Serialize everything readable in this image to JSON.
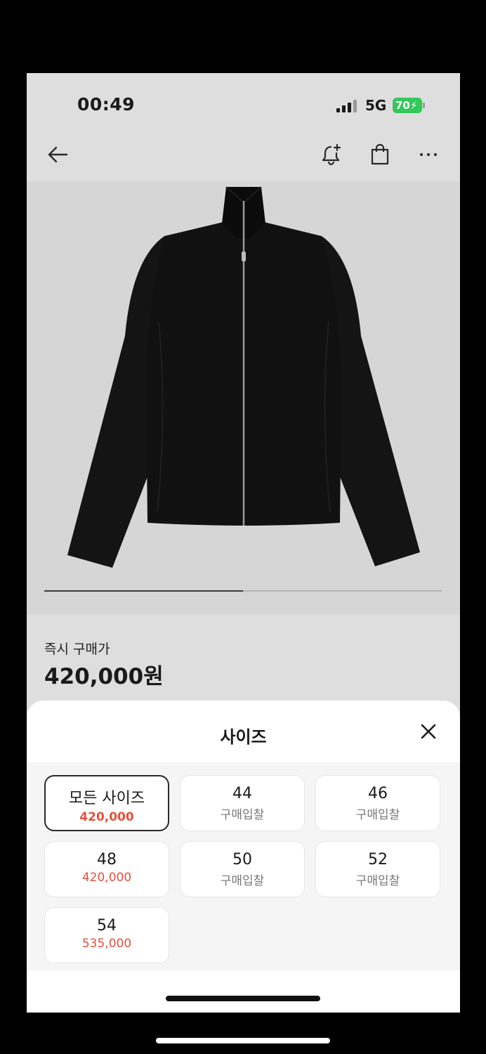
{
  "status": {
    "time": "00:49",
    "network": "5G",
    "battery": "70"
  },
  "nav": {
    "back_icon": "arrow-left-icon",
    "alert_icon": "bell-plus-icon",
    "cart_icon": "shopping-bag-icon",
    "more_icon": "more-horizontal-icon"
  },
  "gallery": {
    "progress": 0.5,
    "image": "black zip-up jacket"
  },
  "price": {
    "label": "즉시 구매가",
    "value": "420,000원"
  },
  "sheet": {
    "title": "사이즈",
    "close_icon": "close-icon",
    "sizes": [
      {
        "name": "모든 사이즈",
        "sub": "420,000",
        "priced": true,
        "selected": true
      },
      {
        "name": "44",
        "sub": "구매입찰",
        "priced": false,
        "selected": false
      },
      {
        "name": "46",
        "sub": "구매입찰",
        "priced": false,
        "selected": false
      },
      {
        "name": "48",
        "sub": "420,000",
        "priced": true,
        "selected": false
      },
      {
        "name": "50",
        "sub": "구매입찰",
        "priced": false,
        "selected": false
      },
      {
        "name": "52",
        "sub": "구매입찰",
        "priced": false,
        "selected": false
      },
      {
        "name": "54",
        "sub": "535,000",
        "priced": true,
        "selected": false
      }
    ]
  },
  "colors": {
    "price_accent": "#e0533e",
    "battery": "#34c759"
  }
}
